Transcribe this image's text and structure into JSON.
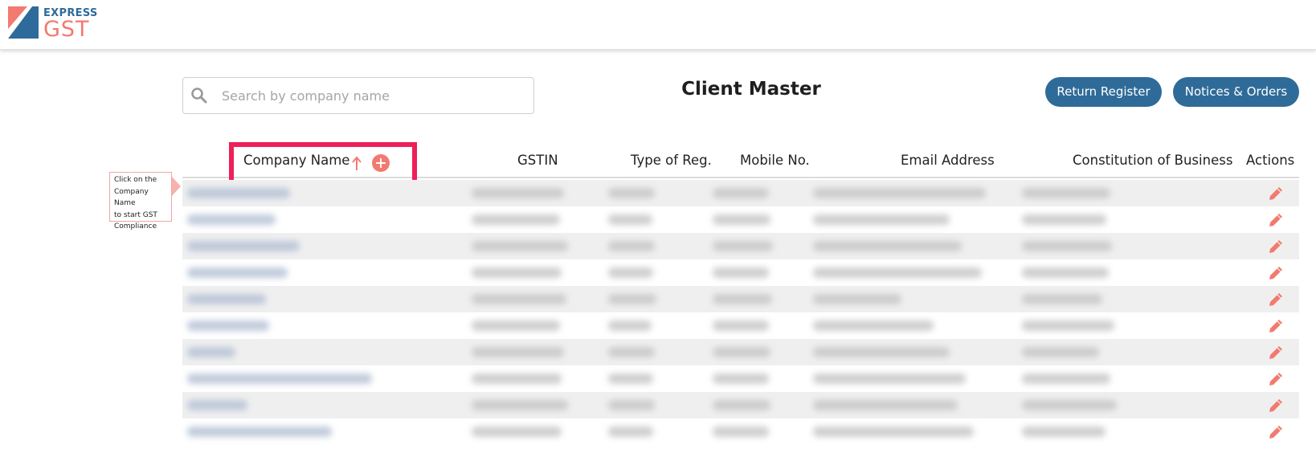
{
  "app": {
    "logo_top": "EXPRESS",
    "logo_bottom": "GST",
    "logo_colors": {
      "blue": "#2e6b9a",
      "coral": "#f27a6f"
    }
  },
  "search": {
    "placeholder": "Search by company name",
    "value": ""
  },
  "page": {
    "title": "Client Master"
  },
  "buttons": {
    "return_register": "Return Register",
    "notices_orders": "Notices & Orders"
  },
  "table": {
    "columns": {
      "company": "Company Name",
      "gstin": "GSTIN",
      "type": "Type of Reg.",
      "mobile": "Mobile No.",
      "email": "Email Address",
      "constitution": "Constitution of Business",
      "actions": "Actions"
    },
    "row_count": 10,
    "rows_blurred": true
  },
  "tooltip": {
    "lines": [
      "Click on the",
      "Company Name",
      "to start GST",
      "Compliance"
    ]
  },
  "colors": {
    "accent": "#f27a6f",
    "primary": "#2f6b98",
    "highlight": "#ef1f5a"
  },
  "icons": [
    "search-icon",
    "sort-ascending-icon",
    "add-circle-icon",
    "pencil-edit-icon"
  ]
}
